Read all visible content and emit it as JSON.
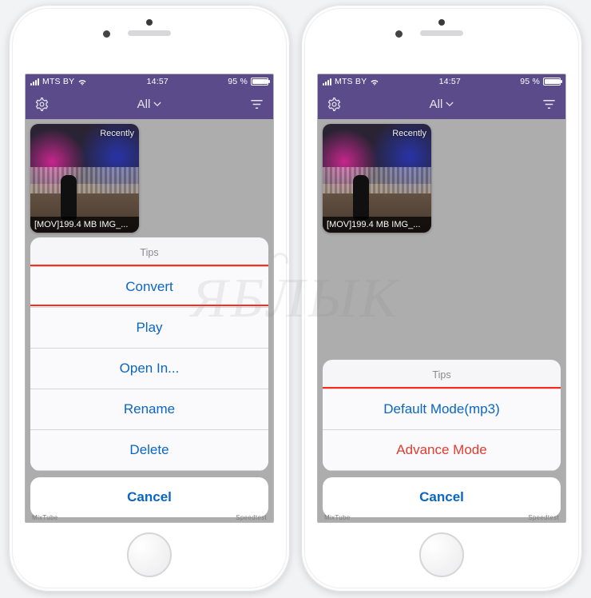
{
  "status": {
    "carrier": "MTS BY",
    "time": "14:57",
    "battery_pct": "95 %",
    "battery_fill_css": "width:95%"
  },
  "nav": {
    "title": "All",
    "settings_icon": "gear",
    "filter_icon": "filter"
  },
  "thumbnail": {
    "badge": "Recently",
    "caption": "[MOV]199.4 MB IMG_..."
  },
  "sheets": {
    "left": {
      "title": "Tips",
      "items": [
        {
          "label": "Convert",
          "destructive": false
        },
        {
          "label": "Play",
          "destructive": false
        },
        {
          "label": "Open In...",
          "destructive": false
        },
        {
          "label": "Rename",
          "destructive": false
        },
        {
          "label": "Delete",
          "destructive": false
        }
      ],
      "cancel": "Cancel",
      "highlight_index": 0
    },
    "right": {
      "title": "Tips",
      "items": [
        {
          "label": "Default Mode(mp3)",
          "destructive": false
        },
        {
          "label": "Advance Mode",
          "destructive": true
        }
      ],
      "cancel": "Cancel",
      "highlight_range": [
        0,
        1
      ]
    }
  },
  "watermark": "ЯБЛЫК"
}
